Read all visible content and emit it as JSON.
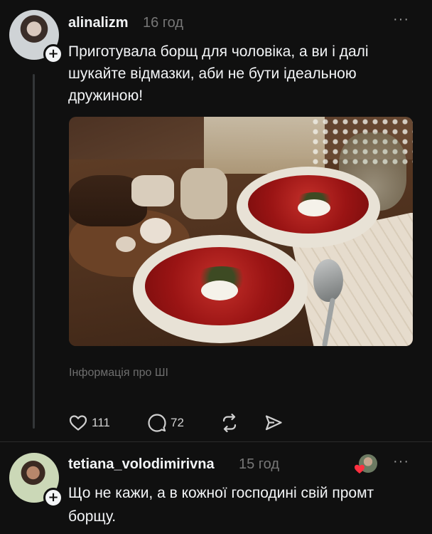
{
  "post": {
    "username": "alinalizm",
    "time": "16 год",
    "more": "···",
    "text": "Приготувала борщ для чоловіка, а ви і далі шукайте відмазки, аби не бути ідеальною дружиною!",
    "image_icon": "borscht-photo",
    "ai_info": "Інформація про ШІ",
    "actions": {
      "likes": "111",
      "comments": "72"
    }
  },
  "reply": {
    "username": "tetiana_volodimirivna",
    "time": "15 год",
    "more": "···",
    "text": "Що не кажи, а в кожної господині свій промт борщу."
  },
  "icons": {
    "follow": "+",
    "like": "heart-icon",
    "comment": "comment-icon",
    "repost": "repost-icon",
    "share": "share-icon"
  },
  "colors": {
    "background": "#101010",
    "text": "#f3f5f7",
    "muted": "#777777",
    "like_badge": "#ff3040"
  }
}
